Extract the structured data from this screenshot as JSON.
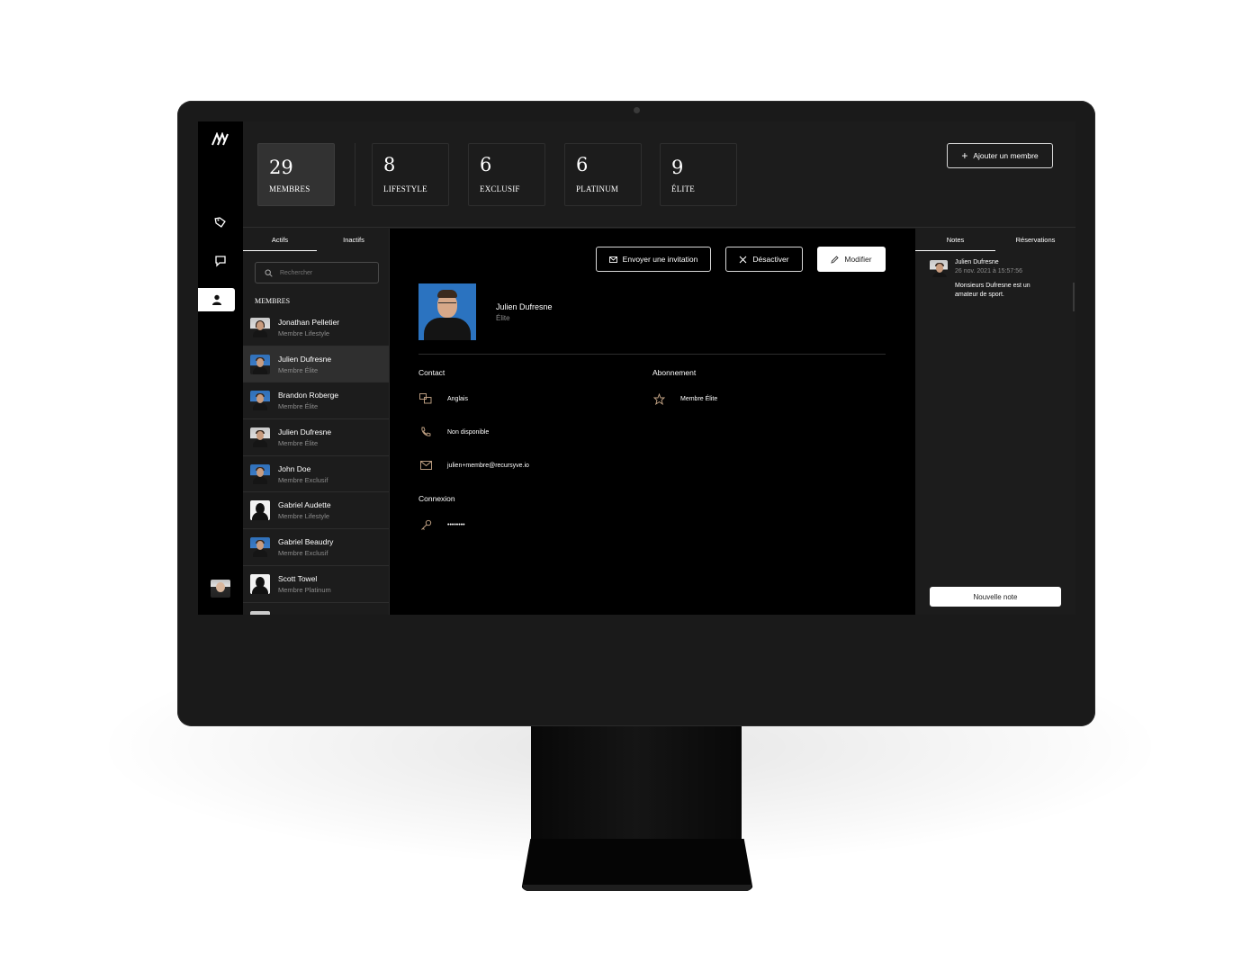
{
  "stats": [
    {
      "value": "29",
      "label": "MEMBRES"
    },
    {
      "value": "8",
      "label": "LIFESTYLE"
    },
    {
      "value": "6",
      "label": "EXCLUSIF"
    },
    {
      "value": "6",
      "label": "PLATINUM"
    },
    {
      "value": "9",
      "label": "ÉLITE"
    }
  ],
  "header": {
    "add_member_label": "Ajouter un membre"
  },
  "sidebar": {
    "icons": [
      "logo-icon",
      "tag-icon",
      "chat-icon",
      "user-icon"
    ]
  },
  "list": {
    "tabs": [
      "Actifs",
      "Inactifs"
    ],
    "search_placeholder": "Rechercher",
    "section_title": "MEMBRES",
    "members": [
      {
        "name": "Jonathan Pelletier",
        "tier": "Membre Lifestyle"
      },
      {
        "name": "Julien Dufresne",
        "tier": "Membre Élite"
      },
      {
        "name": "Brandon Roberge",
        "tier": "Membre Élite"
      },
      {
        "name": "Julien Dufresne",
        "tier": "Membre Élite"
      },
      {
        "name": "John Doe",
        "tier": "Membre Exclusif"
      },
      {
        "name": "Gabriel Audette",
        "tier": "Membre Lifestyle"
      },
      {
        "name": "Gabriel Beaudry",
        "tier": "Membre Exclusif"
      },
      {
        "name": "Scott Towel",
        "tier": "Membre Platinum"
      }
    ]
  },
  "detail": {
    "invite_label": "Envoyer une invitation",
    "deactivate_label": "Désactiver",
    "edit_label": "Modifier",
    "name": "Julien Dufresne",
    "tier": "Élite",
    "contact_title": "Contact",
    "language": "Anglais",
    "phone": "Non disponible",
    "email": "julien+membre@recursyve.io",
    "subscription_title": "Abonnement",
    "subscription": "Membre Élite",
    "login_title": "Connexion",
    "password": "••••••••"
  },
  "notes": {
    "tabs": [
      "Notes",
      "Réservations"
    ],
    "author": "Julien Dufresne",
    "date": "26 nov. 2021 à 15:57:56",
    "text": "Monsieurs Dufresne est un amateur de sport.",
    "new_note_label": "Nouvelle note"
  },
  "colors": {
    "background": "#000000",
    "panel": "#1c1c1c",
    "accent": "#ffffff"
  }
}
